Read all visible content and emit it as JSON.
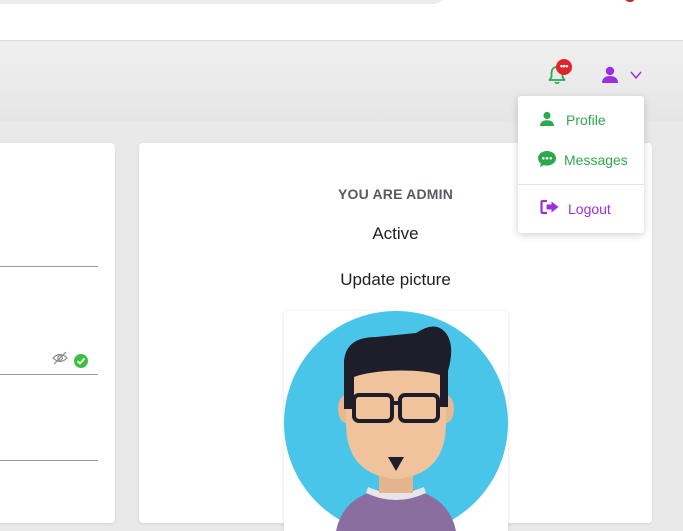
{
  "header": {
    "notifications": {
      "icon": "bell-icon",
      "badge": "•••",
      "color": "#2ea84f",
      "badge_color": "#e0242c"
    },
    "user_menu": {
      "icon": "user-icon",
      "chevron": "chevron-down-icon",
      "color": "#9b2fe0"
    }
  },
  "dropdown": {
    "items": [
      {
        "label": "Profile",
        "icon": "user-icon",
        "color": "#2ea84f"
      },
      {
        "label": "Messages",
        "icon": "chat-bubble-icon",
        "color": "#2ea84f"
      },
      {
        "label": "Logout",
        "icon": "logout-icon",
        "color": "#9b2fe0"
      }
    ]
  },
  "profile_card": {
    "role_title": "YOU ARE ADMIN",
    "status": "Active",
    "update_picture": "Update picture",
    "avatar": {
      "description_icon": "avatar-icon",
      "bg_color": "#49c5ea"
    }
  },
  "left_card": {
    "password_field": {
      "visibility_icon": "eye-off-icon",
      "valid_icon": "check-circle-icon"
    }
  }
}
